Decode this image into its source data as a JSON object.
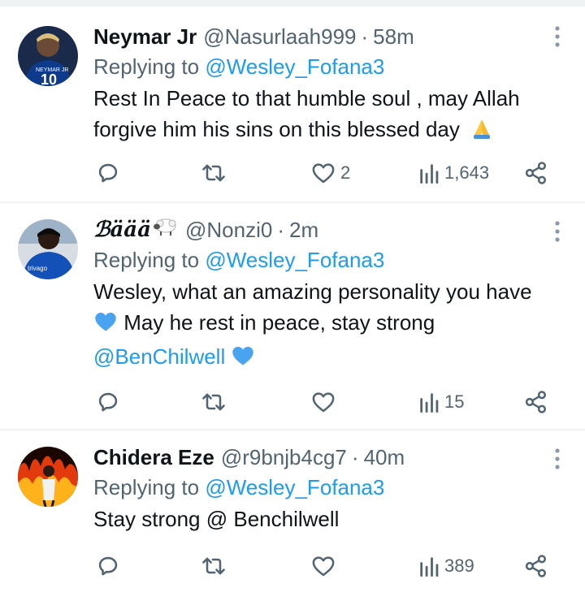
{
  "tweets": [
    {
      "display_name": "Neymar Jr",
      "handle": "@Nasurlaah999",
      "separator": "·",
      "time": "58m",
      "replying_prefix": "Replying to",
      "replying_to": "@Wesley_Fofana3",
      "text_lines": [
        "Rest In Peace to that humble soul , may Allah",
        "forgive him his sins on this blessed day"
      ],
      "text_emoji": "folded-hands",
      "avatar": "player-in-blue-jersey-neymar-10",
      "actions": {
        "reply_count": "",
        "retweet_count": "",
        "like_count": "2",
        "views_count": "1,643"
      }
    },
    {
      "display_name": "ℬäää",
      "display_name_emoji": "sheep",
      "handle": "@Nonzi0",
      "separator": "·",
      "time": "2m",
      "replying_prefix": "Replying to",
      "replying_to": "@Wesley_Fofana3",
      "text_line1": "Wesley, what an amazing personality you have",
      "text_line2": "May he rest in peace, stay strong",
      "text_mention": "@BenChilwell",
      "text_emoji": "blue-heart",
      "avatar": "player-in-blue-trivago-jersey",
      "actions": {
        "reply_count": "",
        "retweet_count": "",
        "like_count": "",
        "views_count": "15"
      }
    },
    {
      "display_name": "Chidera Eze",
      "handle": "@r9bnjb4cg7",
      "separator": "·",
      "time": "40m",
      "replying_prefix": "Replying to",
      "replying_to": "@Wesley_Fofana3",
      "text": "Stay strong @ Benchilwell",
      "avatar": "figure-with-fire-background",
      "actions": {
        "reply_count": "",
        "retweet_count": "",
        "like_count": "",
        "views_count": "389"
      }
    }
  ],
  "colors": {
    "text": "#0f1419",
    "secondary": "#536471",
    "link": "#1d9bf0",
    "divider": "#eff3f4"
  }
}
